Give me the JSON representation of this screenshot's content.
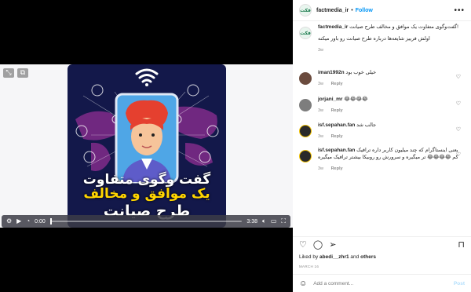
{
  "post": {
    "username": "factmedia_ir",
    "follow_label": "Follow",
    "dot": "•",
    "more_icon": "more-icon",
    "avatar_text": "فکت"
  },
  "video": {
    "title_line1": "گفت وگوی متفاوت",
    "title_line2": "یک موافق و مخالف",
    "title_line3": "طرح صیانت",
    "current_time": "0:00",
    "duration": "3:38",
    "progress": 0.0
  },
  "caption": {
    "username": "factmedia_ir",
    "line1": "گفت‌وگوی متفاوت یک موافق و مخالف طرح صیانت!",
    "line2": "اولش فرییز شایعه‌ها درباره طرح صیانت رو باور میکنه",
    "time": "3w"
  },
  "comments": [
    {
      "username": "iman1992n",
      "text": "خیلی خوب بود",
      "time": "3w",
      "reply": "Reply",
      "avatar_color": "#6b4b3e"
    },
    {
      "username": "jorjani_mr",
      "text": "😂😂😂😂",
      "time": "3w",
      "reply": "Reply",
      "avatar_color": "#7d7d7d"
    },
    {
      "username": "isf.sepahan.fan",
      "text": "جالب شد",
      "time": "3w",
      "reply": "Reply",
      "avatar_color": "#2a2a2a"
    },
    {
      "username": "isf.sepahan.fan",
      "text": "یعنی اینستاگرام که چند میلیون کاربر داره ترافیک کم 😂😂😂😂 تر میگیره و سرورش رو روبیکا بیشتر ترافیک میگیره",
      "time": "3w",
      "reply": "Reply",
      "avatar_color": "#2a2a2a"
    }
  ],
  "likes": {
    "prefix": "Liked by",
    "user": "abedi__zhr1",
    "and": "and",
    "others": "others"
  },
  "date": "MARCH 16",
  "add_comment": {
    "placeholder": "Add a comment...",
    "post_label": "Post"
  },
  "colors": {
    "accent": "#0095f6",
    "poster_bg": "#13184a"
  }
}
